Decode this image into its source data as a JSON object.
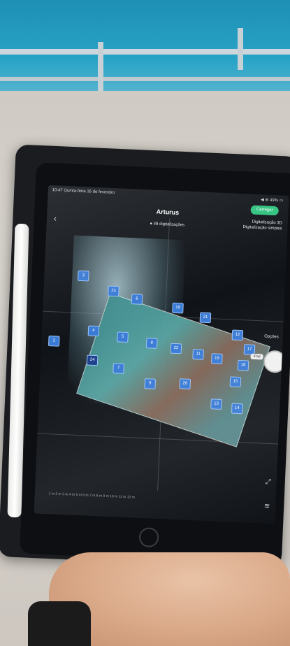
{
  "status_bar": {
    "time_date": "10:47  Quinta-feira 16 de fevereiro",
    "battery": "◀ ⊛ 49% ▭"
  },
  "app": {
    "title": "Arturus",
    "subtitle": "● 48 digitalizações",
    "upload_button": "Carregar",
    "scan_options": [
      "Digitalização 3D",
      "Digitalização simples"
    ],
    "options_label": "Opções",
    "device_tag": "iPad"
  },
  "markers": [
    "3",
    "2",
    "23",
    "6",
    "19",
    "21",
    "5",
    "8",
    "22",
    "11",
    "19",
    "12",
    "17",
    "16",
    "24",
    "7",
    "9",
    "20",
    "15",
    "13",
    "14",
    "4"
  ],
  "scale_bar": "1 m    2 m    3 m    4 m    5 m    6 m    7 m    8 m    9 m    10 m    11 m    12 m",
  "icons": {
    "back": "chevron-left-icon",
    "layers": "layers-icon",
    "measure": "measure-icon"
  }
}
